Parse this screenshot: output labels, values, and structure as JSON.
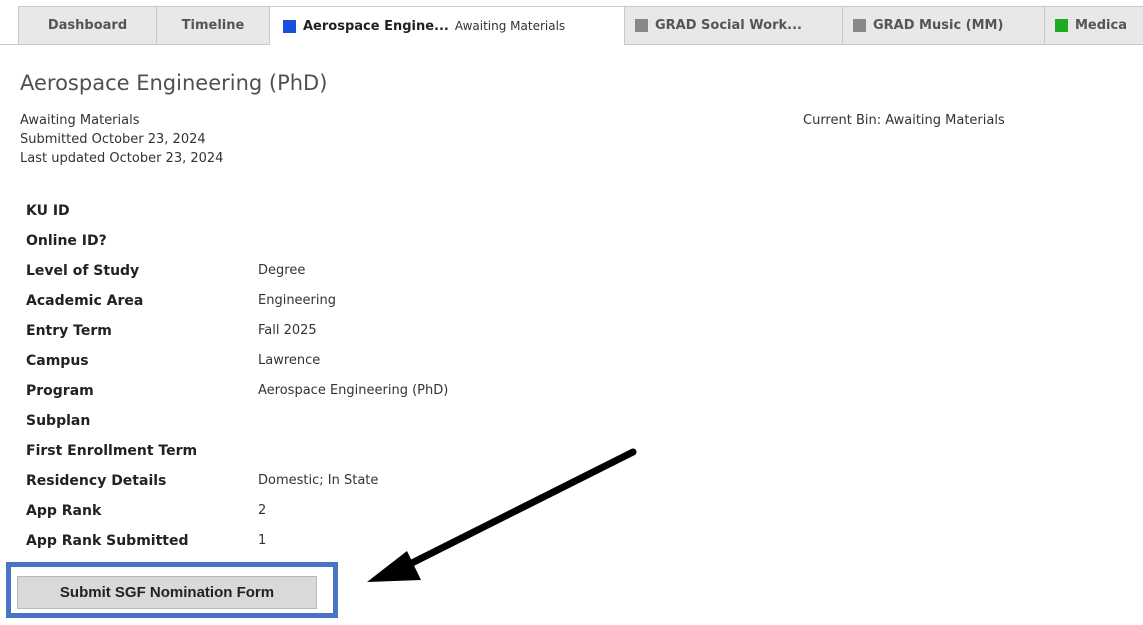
{
  "tabs": {
    "dashboard": {
      "label": "Dashboard"
    },
    "timeline": {
      "label": "Timeline"
    },
    "aerospace": {
      "label": "Aerospace Engine...",
      "status": "Awaiting Materials",
      "color": "#1a4fdc"
    },
    "social_work": {
      "label": "GRAD Social Work...",
      "color": "#888888"
    },
    "music": {
      "label": "GRAD Music (MM)",
      "color": "#888888"
    },
    "medical": {
      "label": "Medica",
      "color": "#1faa1f"
    }
  },
  "application": {
    "title": "Aerospace Engineering (PhD)",
    "status": "Awaiting Materials",
    "submitted": "Submitted October 23, 2024",
    "last_updated": "Last updated October 23, 2024",
    "current_bin": "Current Bin: Awaiting Materials"
  },
  "details": [
    {
      "label": "KU ID",
      "value": ""
    },
    {
      "label": "Online ID?",
      "value": ""
    },
    {
      "label": "Level of Study",
      "value": "Degree"
    },
    {
      "label": "Academic Area",
      "value": "Engineering"
    },
    {
      "label": "Entry Term",
      "value": "Fall 2025"
    },
    {
      "label": "Campus",
      "value": "Lawrence"
    },
    {
      "label": "Program",
      "value": "Aerospace Engineering (PhD)"
    },
    {
      "label": "Subplan",
      "value": ""
    },
    {
      "label": "First Enrollment Term",
      "value": ""
    },
    {
      "label": "Residency Details",
      "value": "Domestic; In State"
    },
    {
      "label": "App Rank",
      "value": "2"
    },
    {
      "label": "App Rank Submitted",
      "value": "1"
    }
  ],
  "actions": {
    "submit_sgf_label": "Submit SGF Nomination Form"
  },
  "annotation": {
    "highlight_color": "#4874c3",
    "arrow_color": "#000000"
  }
}
